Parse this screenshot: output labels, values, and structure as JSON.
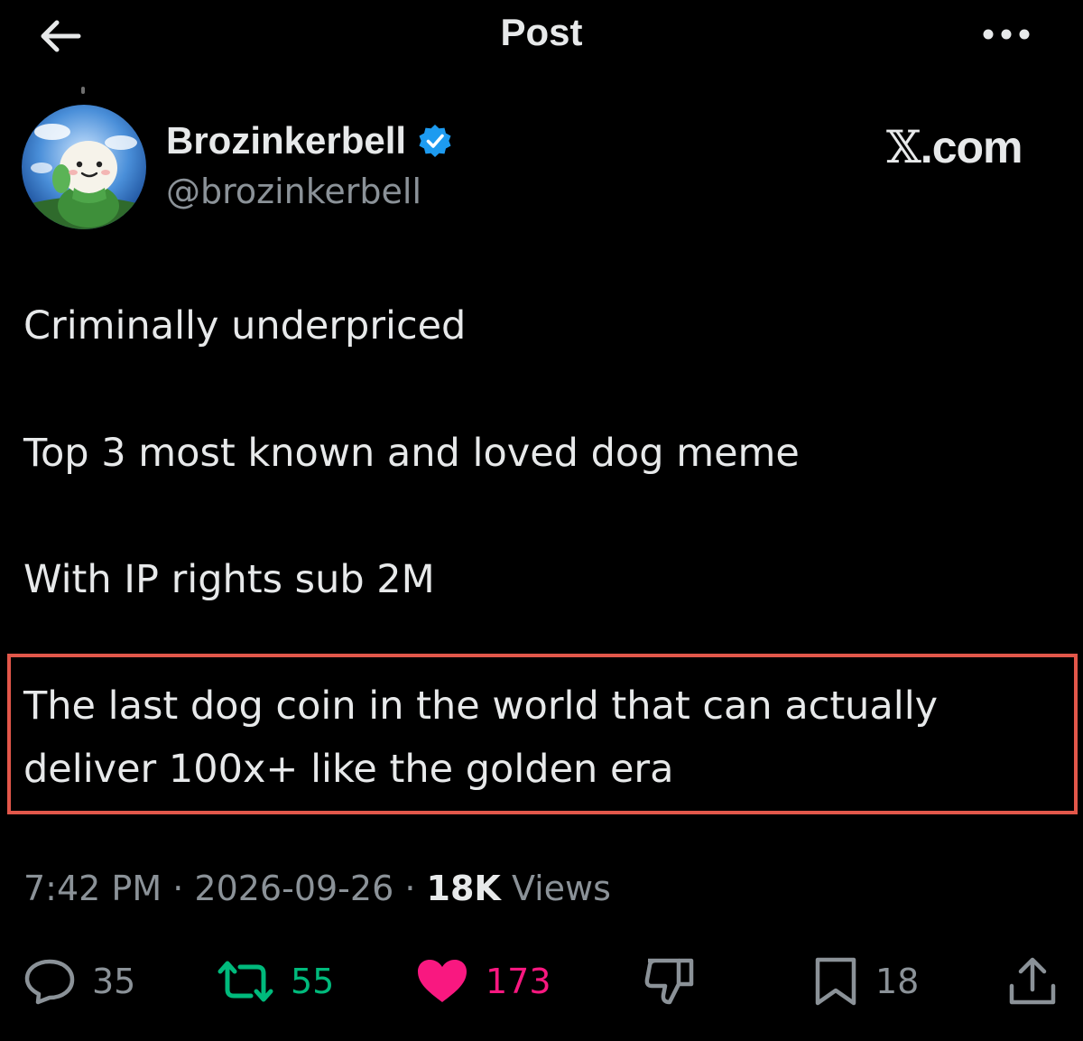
{
  "header": {
    "title": "Post",
    "back_icon": "arrow-left-icon",
    "more_icon": "more-dots-icon"
  },
  "author": {
    "name": "Brozinkerbell",
    "handle": "@brozinkerbell",
    "verified_icon": "verified-badge-icon",
    "verified_color": "#1d9bf0"
  },
  "brand": {
    "x": "𝕏",
    "suffix": ".com"
  },
  "post": {
    "paragraphs": [
      "Criminally underpriced",
      "Top 3 most known and loved dog meme",
      "With IP rights sub 2M"
    ],
    "highlight_lines": [
      "The last dog coin in the world that can actually",
      "deliver 100x+ like the golden era"
    ],
    "highlight_color": "#e2574a"
  },
  "meta": {
    "time": "7:42 PM",
    "sep": "·",
    "date": "2026-09-26",
    "views_count": "18K",
    "views_label": "Views"
  },
  "actions": {
    "reply": {
      "icon": "reply-icon",
      "count": "35",
      "color": "#8b9298"
    },
    "repost": {
      "icon": "repost-icon",
      "count": "55",
      "color": "#00ba7c"
    },
    "like": {
      "icon": "heart-icon",
      "count": "173",
      "color": "#f91880"
    },
    "dislike": {
      "icon": "thumbs-down-icon",
      "color": "#8b9298"
    },
    "bookmark": {
      "icon": "bookmark-icon",
      "count": "18",
      "color": "#8b9298"
    },
    "share": {
      "icon": "share-icon",
      "color": "#8b9298"
    }
  }
}
